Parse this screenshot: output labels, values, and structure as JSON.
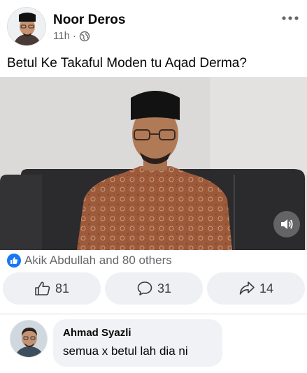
{
  "post": {
    "author": "Noor Deros",
    "time": "11h",
    "separator": "·",
    "caption": "Betul Ke Takaful Moden tu Aqad Derma?"
  },
  "reactions": {
    "summary": "Akik Abdullah and 80 others"
  },
  "actions": {
    "likes": "81",
    "comments": "31",
    "shares": "14"
  },
  "comment": {
    "author": "Ahmad Syazli",
    "text": "semua x betul lah dia ni"
  },
  "colors": {
    "accent": "#1877f2",
    "secondary_text": "#65676b",
    "button_bg": "#eef0f3",
    "bubble_bg": "#f0f2f5"
  },
  "icons": {
    "visibility": "globe-icon",
    "more": "more-horizontal-icon",
    "sound": "speaker-icon",
    "like": "thumbs-up-icon",
    "comment": "comment-icon",
    "share": "share-icon"
  }
}
